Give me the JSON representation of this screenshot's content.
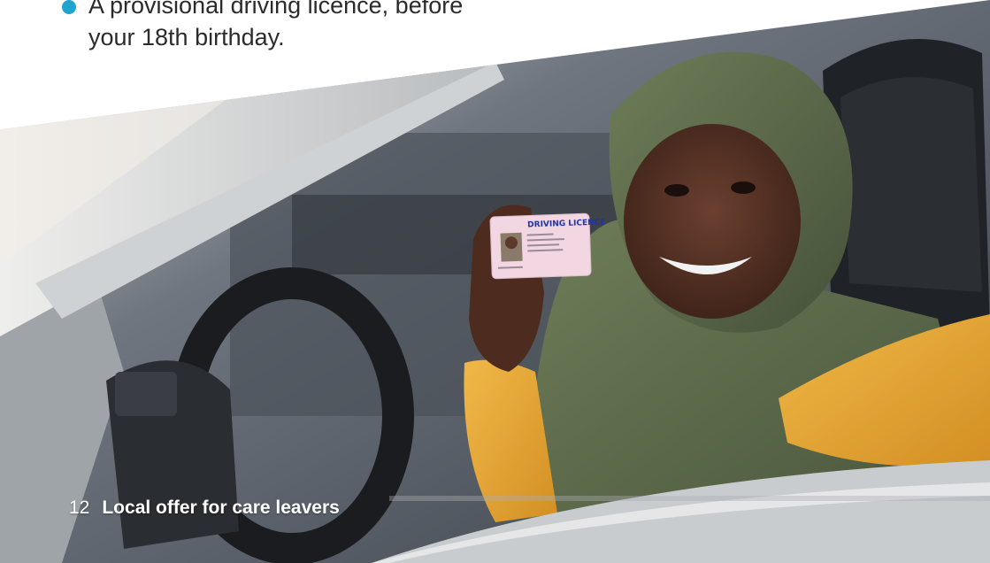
{
  "bullet": {
    "line1": "A provisional driving licence, before",
    "line2": "your 18th birthday."
  },
  "licence_card": {
    "heading": "DRIVING LICENCE"
  },
  "footer": {
    "page_number": "12",
    "title": "Local offer for care leavers"
  },
  "colors": {
    "bullet": "#1fa3cf",
    "text": "#2b2b2b",
    "sweater": "#e8a93a",
    "hijab": "#5a6a48"
  },
  "icons": [
    "bullet-dot-icon"
  ]
}
